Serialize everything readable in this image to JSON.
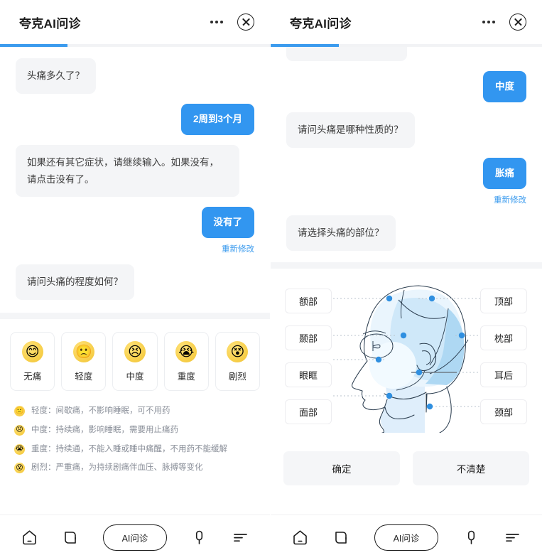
{
  "app": {
    "title": "夸克AI问诊",
    "progress_percent": 25,
    "accent_color": "#3296f0",
    "progress_color": "#3b9bee",
    "bot_bubble_color": "#f4f5f7",
    "link_color": "#3b9bee"
  },
  "header": {
    "more_icon": "more-horizontal-icon",
    "close_icon": "close-circle-icon"
  },
  "left_panel": {
    "messages": [
      {
        "role": "bot",
        "text": "头痛多久了？"
      },
      {
        "role": "user",
        "text": "2周到3个月"
      },
      {
        "role": "bot",
        "text": "如果还有其它症状，请继续输入。如果没有，请点击没有了。"
      },
      {
        "role": "user",
        "text": "没有了",
        "redo_label": "重新修改"
      },
      {
        "role": "bot",
        "text": "请问头痛的程度如何？"
      }
    ],
    "severity_options": [
      {
        "label": "无痛",
        "emoji": "😊"
      },
      {
        "label": "轻度",
        "emoji": "🙁"
      },
      {
        "label": "中度",
        "emoji": "😣"
      },
      {
        "label": "重度",
        "emoji": "😭"
      },
      {
        "label": "剧烈",
        "emoji": "😵"
      }
    ],
    "legend": [
      {
        "emoji": "🙁",
        "text": "轻度：间歇痛，不影响睡眠，可不用药"
      },
      {
        "emoji": "😣",
        "text": "中度：持续痛，影响睡眠，需要用止痛药"
      },
      {
        "emoji": "😭",
        "text": "重度：持续通，不能入睡或睡中痛醒，不用药不能缓解"
      },
      {
        "emoji": "😵",
        "text": "剧烈：严重痛，为持续剧痛伴血压、脉搏等变化"
      }
    ]
  },
  "right_panel": {
    "messages": [
      {
        "role": "user",
        "text": "中度"
      },
      {
        "role": "bot",
        "text": "请问头痛是哪种性质的？"
      },
      {
        "role": "user",
        "text": "胀痛",
        "redo_label": "重新修改"
      },
      {
        "role": "bot",
        "text": "请选择头痛的部位？"
      }
    ],
    "head_diagram": {
      "left_tags": [
        "额部",
        "颞部",
        "眼眶",
        "面部"
      ],
      "right_tags": [
        "顶部",
        "枕部",
        "耳后",
        "颈部"
      ],
      "dot_color": "#2f8fe0",
      "fill_light": "#eaf5fd",
      "fill_mid": "#cfe8f9",
      "fill_strong": "#aed8f3"
    },
    "actions": [
      {
        "label": "确定"
      },
      {
        "label": "不清楚"
      }
    ]
  },
  "bottom_nav": {
    "items": [
      {
        "icon": "home-icon",
        "label": ""
      },
      {
        "icon": "card-icon",
        "label": ""
      },
      {
        "icon": "ai-consult-pill",
        "label": "AI问诊"
      },
      {
        "icon": "microphone-icon",
        "label": ""
      },
      {
        "icon": "menu-lines-icon",
        "label": ""
      }
    ]
  }
}
